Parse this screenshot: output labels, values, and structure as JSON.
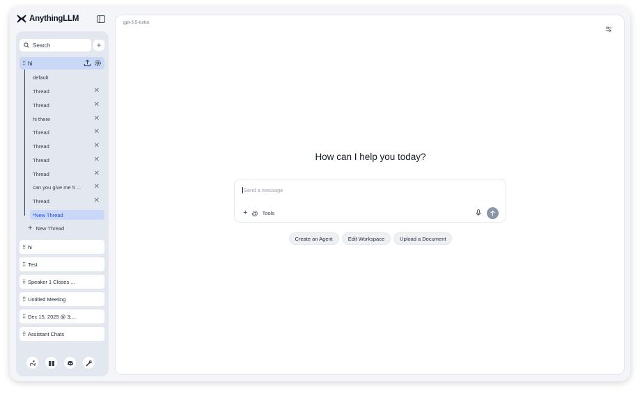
{
  "app": {
    "name": "AnythingLLM"
  },
  "sidebar": {
    "search_placeholder": "Search",
    "active_workspace": {
      "name": "hi",
      "threads": [
        {
          "name": "default",
          "removable": false
        },
        {
          "name": "Thread",
          "removable": true
        },
        {
          "name": "Thread",
          "removable": true
        },
        {
          "name": "hi there",
          "removable": true
        },
        {
          "name": "Thread",
          "removable": true
        },
        {
          "name": "Thread",
          "removable": true
        },
        {
          "name": "Thread",
          "removable": true
        },
        {
          "name": "Thread",
          "removable": true
        },
        {
          "name": "can you give me 5 ...",
          "removable": true
        },
        {
          "name": "Thread",
          "removable": true
        }
      ],
      "current_thread": "*New Thread",
      "new_thread_label": "New Thread"
    },
    "workspaces": [
      "hi",
      "Test",
      "Speaker 1 Closes ...",
      "Untitled Meeting",
      "Dec 15, 2025 @ 3:...",
      "Assistant Chats"
    ],
    "footer_icons": [
      "community-icon",
      "docs-book-icon",
      "discord-icon",
      "settings-wrench-icon"
    ]
  },
  "main": {
    "model": "gpt-3.5-turbo",
    "greeting": "How can I help you today?",
    "composer": {
      "placeholder": "Send a message",
      "tools_label": "Tools"
    },
    "suggestions": [
      "Create an Agent",
      "Edit Workspace",
      "Upload a Document"
    ]
  },
  "colors": {
    "accent_light": "#c9d8f7",
    "sidebar_bg": "#e3e7ef",
    "send_button": "#8b95a5"
  }
}
